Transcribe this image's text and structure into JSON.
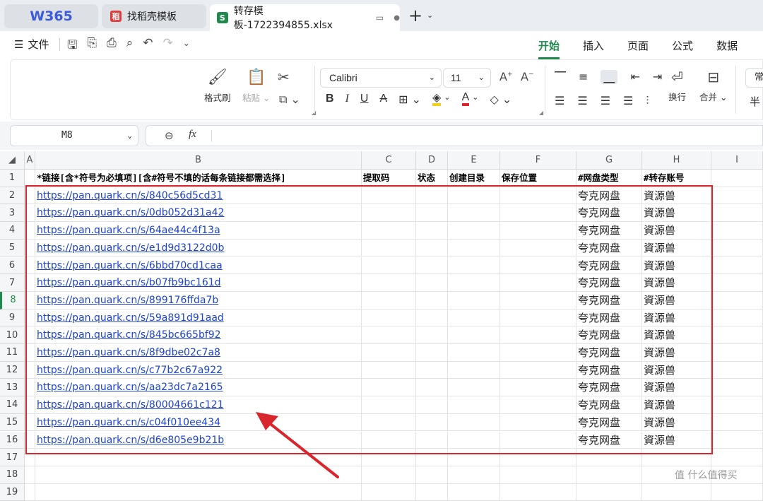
{
  "tabs": {
    "home": "W365",
    "template": "找稻壳模板",
    "file": "转存模板-1722394855.xlsx",
    "new_tab": "+"
  },
  "menu": {
    "file_label": "文件",
    "ribbon_tabs": [
      "开始",
      "插入",
      "页面",
      "公式",
      "数据"
    ]
  },
  "ribbon": {
    "format_painter": "格式刷",
    "paste": "粘贴",
    "font_name": "Calibri",
    "font_size": "11",
    "wrap": "换行",
    "merge": "合并",
    "partial_right": "常",
    "partial_right2": "半"
  },
  "formula": {
    "cell_ref": "M8",
    "fx": "fx"
  },
  "sheet": {
    "columns": [
      "A",
      "B",
      "C",
      "D",
      "E",
      "F",
      "G",
      "H",
      "I"
    ],
    "row_numbers": [
      "1",
      "2",
      "3",
      "4",
      "5",
      "6",
      "7",
      "8",
      "9",
      "10",
      "11",
      "12",
      "13",
      "14",
      "15",
      "16",
      "17",
      "18",
      "19"
    ],
    "header": {
      "B": "*链接[含*符号为必填项][含#符号不填的话每条链接都需选择]",
      "C": "提取码",
      "D": "状态",
      "E": "创建目录",
      "F": "保存位置",
      "G": "#网盘类型",
      "H": "#转存账号"
    },
    "rows": [
      {
        "link": "https://pan.quark.cn/s/840c56d5cd31",
        "type": "夸克网盘",
        "account": "資源兽"
      },
      {
        "link": "https://pan.quark.cn/s/0db052d31a42",
        "type": "夸克网盘",
        "account": "資源兽"
      },
      {
        "link": "https://pan.quark.cn/s/64ae44c4f13a",
        "type": "夸克网盘",
        "account": "資源兽"
      },
      {
        "link": "https://pan.quark.cn/s/e1d9d3122d0b",
        "type": "夸克网盘",
        "account": "資源兽"
      },
      {
        "link": "https://pan.quark.cn/s/6bbd70cd1caa",
        "type": "夸克网盘",
        "account": "資源兽"
      },
      {
        "link": "https://pan.quark.cn/s/b07fb9bc161d",
        "type": "夸克网盘",
        "account": "資源兽"
      },
      {
        "link": "https://pan.quark.cn/s/899176ffda7b",
        "type": "夸克网盘",
        "account": "資源兽"
      },
      {
        "link": "https://pan.quark.cn/s/59a891d91aad",
        "type": "夸克网盘",
        "account": "資源兽"
      },
      {
        "link": "https://pan.quark.cn/s/845bc665bf92",
        "type": "夸克网盘",
        "account": "資源兽"
      },
      {
        "link": "https://pan.quark.cn/s/8f9dbe02c7a8",
        "type": "夸克网盘",
        "account": "資源兽"
      },
      {
        "link": "https://pan.quark.cn/s/c77b2c67a922",
        "type": "夸克网盘",
        "account": "資源兽"
      },
      {
        "link": "https://pan.quark.cn/s/aa23dc7a2165",
        "type": "夸克网盘",
        "account": "資源兽"
      },
      {
        "link": "https://pan.quark.cn/s/80004661c121",
        "type": "夸克网盘",
        "account": "資源兽"
      },
      {
        "link": "https://pan.quark.cn/s/c04f010ee434",
        "type": "夸克网盘",
        "account": "資源兽"
      },
      {
        "link": "https://pan.quark.cn/s/d6e805e9b21b",
        "type": "夸克网盘",
        "account": "資源兽"
      }
    ]
  },
  "watermark": "值 什么值得买",
  "colors": {
    "highlight_red": "#d9262c",
    "link_blue": "#1d43d1",
    "accent_green": "#1f8a4c"
  }
}
